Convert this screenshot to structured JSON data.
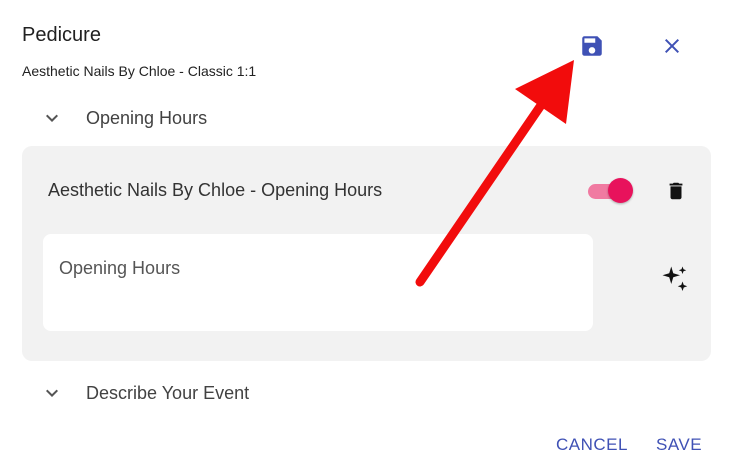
{
  "header": {
    "title": "Pedicure",
    "subtitle": "Aesthetic Nails By Chloe - Classic 1:1"
  },
  "sections": [
    {
      "label": "Opening Hours"
    },
    {
      "label": "Describe Your Event"
    }
  ],
  "panel": {
    "title": "Aesthetic Nails By Chloe - Opening Hours",
    "toggle_on": true,
    "input_placeholder": "Opening Hours"
  },
  "footer": {
    "cancel_label": "CANCEL",
    "save_label": "SAVE"
  },
  "colors": {
    "accent": "#3f51b5",
    "toggle": "#e8125c",
    "annotation_arrow": "#f20c0c"
  },
  "icons": [
    "save-icon",
    "close-icon",
    "chevron-down-icon",
    "trash-icon",
    "sparkle-icon"
  ]
}
